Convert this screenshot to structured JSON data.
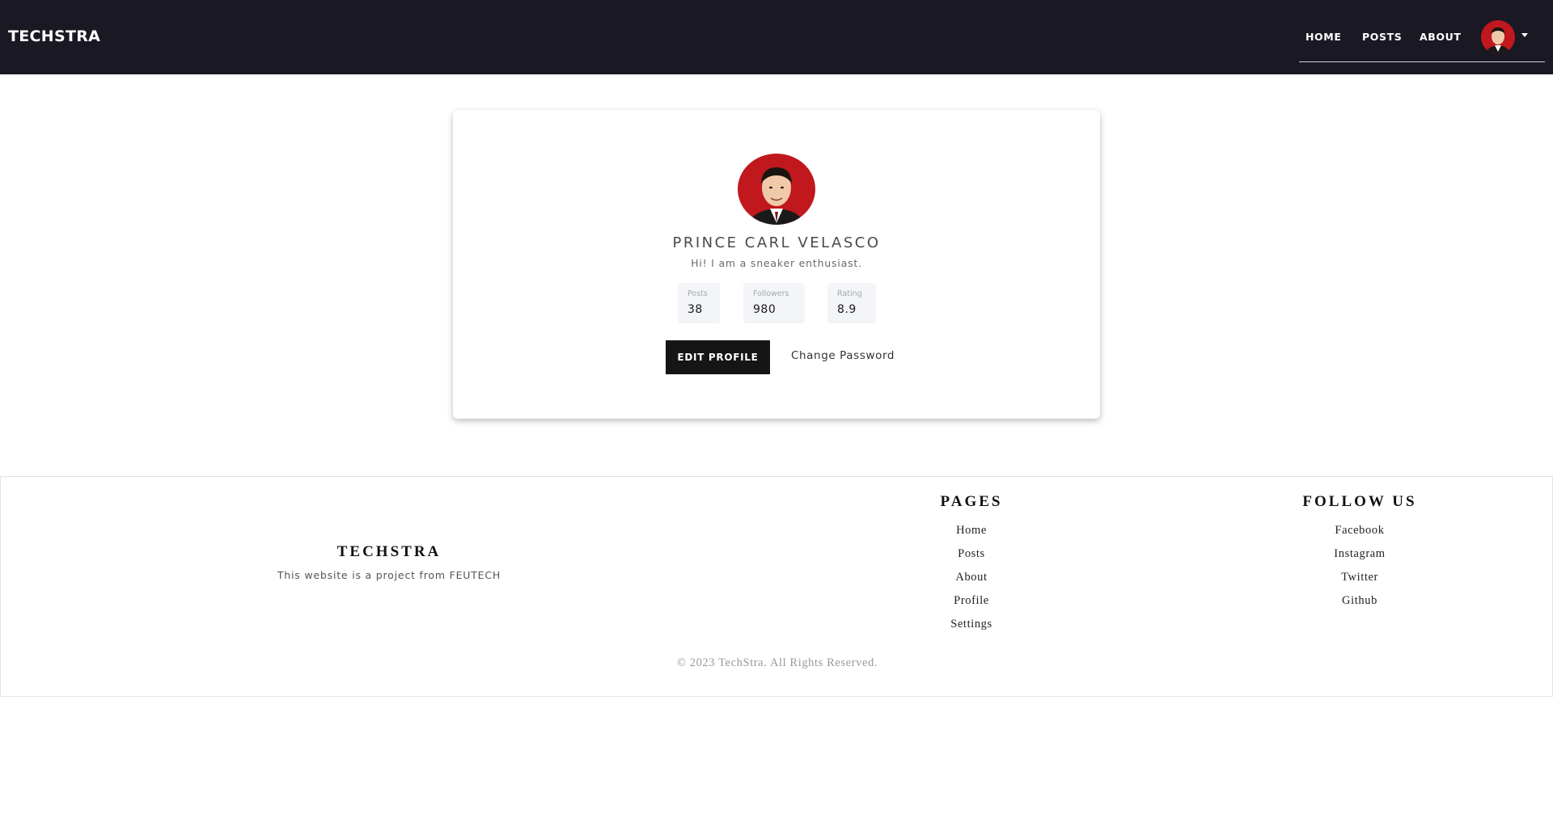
{
  "navbar": {
    "brand": "TECHSTRA",
    "links": [
      "HOME",
      "POSTS",
      "ABOUT"
    ],
    "avatar_icon": "user-avatar-photo",
    "dropdown_icon": "caret-down-icon"
  },
  "profile": {
    "avatar_icon": "user-avatar-photo",
    "name": "PRINCE CARL VELASCO",
    "bio": "Hi! I am a sneaker enthusiast.",
    "stats": [
      {
        "label": "Posts",
        "value": "38"
      },
      {
        "label": "Followers",
        "value": "980"
      },
      {
        "label": "Rating",
        "value": "8.9"
      }
    ],
    "edit_button": "EDIT PROFILE",
    "change_password": "Change Password"
  },
  "footer": {
    "brand": "TECHSTRA",
    "tagline": "This website is a project from FEUTECH",
    "pages_title": "PAGES",
    "pages": [
      "Home",
      "Posts",
      "About",
      "Profile",
      "Settings"
    ],
    "follow_title": "FOLLOW US",
    "follow": [
      "Facebook",
      "Instagram",
      "Twitter",
      "Github"
    ],
    "copyright": "© 2023 TechStra. All Rights Reserved."
  },
  "colors": {
    "navbar_bg": "#1a1823",
    "button_bg": "#151515",
    "avatar_bg": "#c0181d"
  }
}
